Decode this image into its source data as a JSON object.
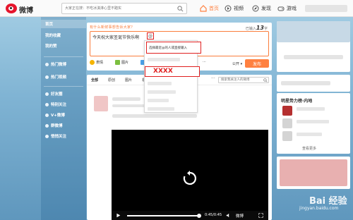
{
  "colors": {
    "accent": "#ff8140",
    "highlight_red": "#e02020",
    "brand_red": "#e6162d"
  },
  "header": {
    "logo_text": "微博",
    "search_placeholder": "大家正在搜：不吃冰淇淋心里不踏实",
    "nav": [
      {
        "label": "首页",
        "icon": "home-icon"
      },
      {
        "label": "视频",
        "icon": "video-icon"
      },
      {
        "label": "发现",
        "icon": "discover-icon"
      },
      {
        "label": "游戏",
        "icon": "game-icon"
      }
    ]
  },
  "sidebar": {
    "items": [
      {
        "label": "首页"
      },
      {
        "label": "我的收藏"
      },
      {
        "label": "我的赞"
      },
      {
        "label": "热门微博"
      },
      {
        "label": "热门视频"
      },
      {
        "label": "好友圈"
      },
      {
        "label": "特别关注"
      },
      {
        "label": "V+微博"
      },
      {
        "label": "群微博"
      },
      {
        "label": "悄悄关注"
      }
    ]
  },
  "composer": {
    "title": "有什么新鲜事想告诉大家？",
    "counter_prefix": "已输入",
    "counter_value": "13",
    "counter_suffix": "字",
    "text": "今天祝大家圣诞节快乐啊",
    "at_symbol": "@",
    "tools": [
      {
        "label": "表情",
        "icon": "emoji-icon"
      },
      {
        "label": "图片",
        "icon": "image-icon"
      },
      {
        "label": "视频",
        "icon": "video-tool-icon"
      }
    ],
    "more": "···",
    "visibility": "公开",
    "publish": "发布"
  },
  "mention_dropdown": {
    "hint": "选择最近@的人或直接输入",
    "selected": "XXXX"
  },
  "feed": {
    "tabs": [
      "全部",
      "原创",
      "图片",
      "视频"
    ],
    "more": "···",
    "search_placeholder": "搜索我关注人的微博"
  },
  "video": {
    "progress": 0.98,
    "time": "0:45/0:45",
    "brand": "微博"
  },
  "right": {
    "stars_title": "明星势力榜·内地",
    "stars_more": "查看更多"
  },
  "watermark": {
    "text": "Bai 经验",
    "sub": "jingyan.baidu.com"
  }
}
